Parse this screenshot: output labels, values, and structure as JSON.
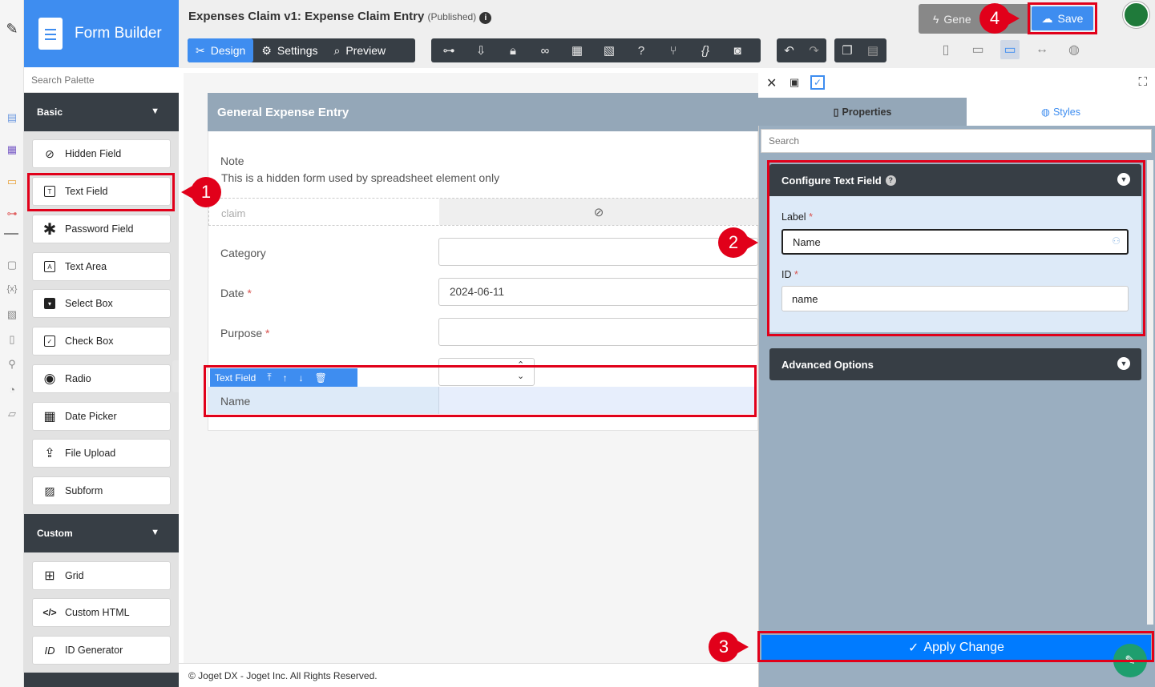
{
  "app": {
    "title": "Form Builder"
  },
  "palette": {
    "search_placeholder": "Search Palette",
    "basic_label": "Basic",
    "custom_label": "Custom",
    "basic_items": [
      "Hidden Field",
      "Text Field",
      "Password Field",
      "Text Area",
      "Select Box",
      "Check Box",
      "Radio",
      "Date Picker",
      "File Upload",
      "Subform"
    ],
    "custom_items": [
      "Grid",
      "Custom HTML",
      "ID Generator"
    ],
    "id_icon_text": "ID"
  },
  "header": {
    "form_title": "Expenses Claim v1: Expense Claim Entry",
    "status": "(Published)",
    "design_label": "Design",
    "settings_label": "Settings",
    "preview_label": "Preview",
    "generate_label": "Gene",
    "save_label": "Save"
  },
  "form": {
    "section_title": "General Expense Entry",
    "note_label": "Note",
    "note_text": "This is a hidden form used by spreadsheet element only",
    "hidden_field_id": "claim",
    "category_label": "Category",
    "date_label": "Date",
    "date_value": "2024-06-11",
    "purpose_label": "Purpose",
    "required_mark": "*",
    "element_toolbar_label": "Text Field",
    "new_field_label": "Name"
  },
  "properties": {
    "properties_tab": "Properties",
    "styles_tab": "Styles",
    "search_placeholder": "Search",
    "configure_title": "Configure Text Field",
    "label_label": "Label",
    "label_value": "Name",
    "id_label": "ID",
    "id_value": "name",
    "advanced_label": "Advanced Options",
    "apply_label": "Apply Change"
  },
  "footer": {
    "copyright": "© Joget DX - Joget Inc. All Rights Reserved."
  },
  "callouts": [
    "1",
    "2",
    "3",
    "4"
  ],
  "colors": {
    "accent": "#3e8df0",
    "dark": "#373e45",
    "highlight": "#e1001a",
    "apply": "#007bff",
    "panel": "#9aaec0"
  }
}
